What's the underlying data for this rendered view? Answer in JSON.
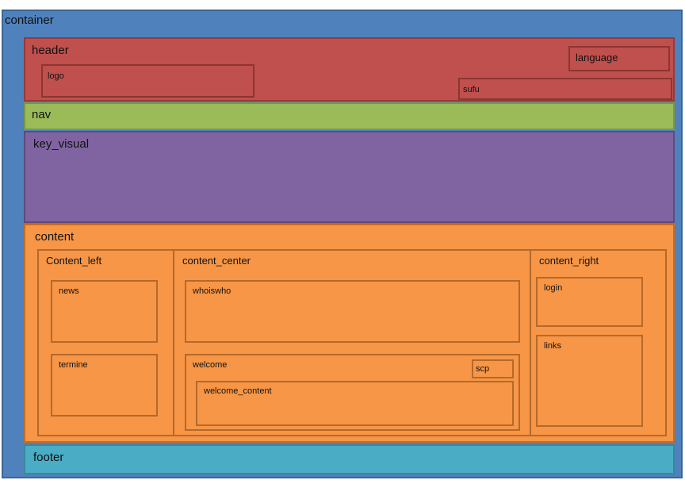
{
  "container": {
    "label": "container"
  },
  "header": {
    "label": "header",
    "logo": "logo",
    "language": "language",
    "sufu": "sufu"
  },
  "nav": {
    "label": "nav"
  },
  "key_visual": {
    "label": "key_visual"
  },
  "content": {
    "label": "content",
    "left": {
      "label": "Content_left",
      "news": "news",
      "termine": "termine"
    },
    "center": {
      "label": "content_center",
      "whoiswho": "whoiswho",
      "welcome": "welcome",
      "scp": "scp",
      "welcome_content": "welcome_content"
    },
    "right": {
      "label": "content_right",
      "login": "login",
      "links": "links"
    }
  },
  "footer": {
    "label": "footer"
  },
  "colors": {
    "container": "#4f81bd",
    "header": "#c0504d",
    "nav": "#9bbb59",
    "key_visual": "#8064a2",
    "content": "#f79646",
    "footer": "#4bacc6"
  }
}
